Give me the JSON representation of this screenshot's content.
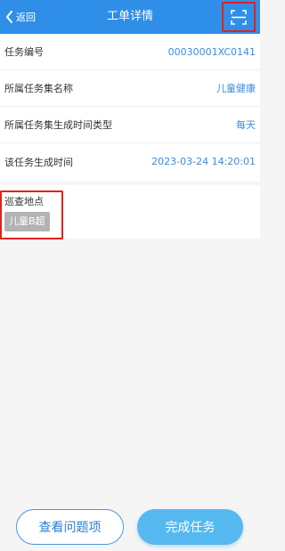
{
  "header": {
    "back_label": "返回",
    "title": "工单详情",
    "scan_icon": "scan-icon"
  },
  "info_rows": [
    {
      "label": "任务编号",
      "value": "00030001XC0141"
    },
    {
      "label": "所属任务集名称",
      "value": "儿童健康"
    },
    {
      "label": "所属任务集生成时间类型",
      "value": "每天"
    },
    {
      "label": "该任务生成时间",
      "value": "2023-03-24 14:20:01"
    }
  ],
  "location": {
    "label": "巡查地点",
    "tag": "儿童B超"
  },
  "actions": {
    "view_issues": "查看问题项",
    "complete_task": "完成任务"
  },
  "colors": {
    "header_bg": "#2f8fe8",
    "value_text": "#3b8ae0",
    "highlight_border": "#e3211c",
    "primary_button": "#55b9ef"
  }
}
